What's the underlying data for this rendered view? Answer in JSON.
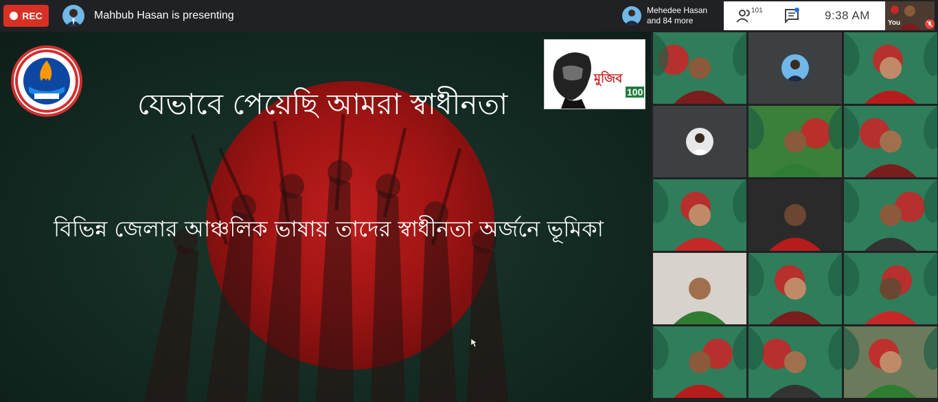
{
  "topbar": {
    "rec_label": "REC",
    "presenting_text": "Mahbub Hasan is presenting",
    "notification_line1": "Mehedee Hasan",
    "notification_line2": "and 84 more",
    "participants_count": "101",
    "clock": "9:38  AM",
    "self_label": "You"
  },
  "slide": {
    "title": "যেভাবে পেয়েছি আমরা স্বাধীনতা",
    "subtitle": "বিভিন্ন জেলার আঞ্চলিক ভাষায় তাদের স্বাধীনতা অর্জনে ভূমিকা",
    "mujib_text": "মুজিব",
    "mujib_number": "100"
  },
  "icons": [
    "record-dot-icon",
    "people-icon",
    "chat-icon",
    "mic-off-icon",
    "cursor-icon"
  ],
  "colors": {
    "rec": "#d93025",
    "flag_red": "#d31a1a",
    "flag_green": "#1e5a3a",
    "chat_dot": "#1a73e8"
  },
  "tiles": [
    {
      "name": "tile-1",
      "kind": "video",
      "bg": "#2f7d5a"
    },
    {
      "name": "tile-2",
      "kind": "avatar",
      "bg": "#3c4043"
    },
    {
      "name": "tile-3",
      "kind": "video",
      "bg": "#2f7d5a"
    },
    {
      "name": "tile-4",
      "kind": "avatar",
      "bg": "#3c4043"
    },
    {
      "name": "tile-5",
      "kind": "video",
      "bg": "#3a7f3a"
    },
    {
      "name": "tile-6",
      "kind": "video",
      "bg": "#2f7d5a"
    },
    {
      "name": "tile-7",
      "kind": "video",
      "bg": "#2f7d5a"
    },
    {
      "name": "tile-8",
      "kind": "video",
      "bg": "#2a2a2a"
    },
    {
      "name": "tile-9",
      "kind": "video",
      "bg": "#2f7d5a"
    },
    {
      "name": "tile-10",
      "kind": "video",
      "bg": "#d8d2cc"
    },
    {
      "name": "tile-11",
      "kind": "video",
      "bg": "#2f7d5a"
    },
    {
      "name": "tile-12",
      "kind": "video",
      "bg": "#2f7d5a"
    },
    {
      "name": "tile-13",
      "kind": "video",
      "bg": "#2f7d5a"
    },
    {
      "name": "tile-14",
      "kind": "video",
      "bg": "#2f7d5a"
    },
    {
      "name": "tile-15",
      "kind": "video",
      "bg": "#6b7a5a"
    }
  ]
}
